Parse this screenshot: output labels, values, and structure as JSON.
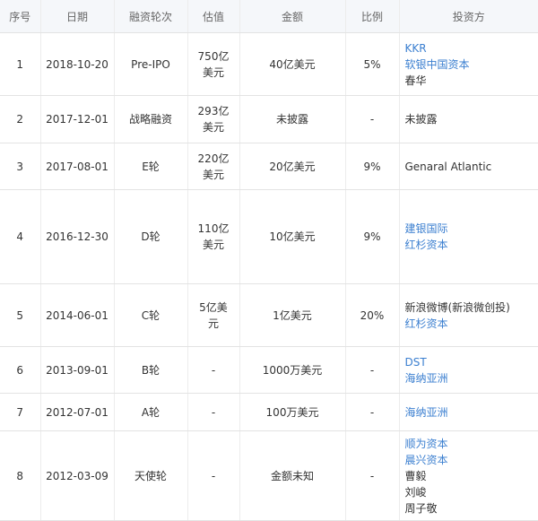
{
  "headers": [
    "序号",
    "日期",
    "融资轮次",
    "估值",
    "金额",
    "比例",
    "投资方"
  ],
  "rows": [
    {
      "no": "1",
      "date": "2018-10-20",
      "round": "Pre-IPO",
      "valuation": [
        "750亿",
        "美元"
      ],
      "amount": "40亿美元",
      "ratio": "5%",
      "investors": [
        {
          "name": "KKR",
          "link": true
        },
        {
          "name": "软银中国资本",
          "link": true
        },
        {
          "name": "春华",
          "link": false
        }
      ]
    },
    {
      "no": "2",
      "date": "2017-12-01",
      "round": "战略融资",
      "valuation": [
        "293亿",
        "美元"
      ],
      "amount": "未披露",
      "ratio": "-",
      "investors": [
        {
          "name": "未披露",
          "link": false
        }
      ]
    },
    {
      "no": "3",
      "date": "2017-08-01",
      "round": "E轮",
      "valuation": [
        "220亿",
        "美元"
      ],
      "amount": "20亿美元",
      "ratio": "9%",
      "investors": [
        {
          "name": "Genaral Atlantic",
          "link": false
        }
      ]
    },
    {
      "no": "4",
      "date": "2016-12-30",
      "round": "D轮",
      "valuation": [
        "110亿",
        "美元"
      ],
      "amount": "10亿美元",
      "ratio": "9%",
      "investors": [
        {
          "name": "建银国际",
          "link": true
        },
        {
          "name": "红杉资本",
          "link": true
        }
      ]
    },
    {
      "no": "5",
      "date": "2014-06-01",
      "round": "C轮",
      "valuation": [
        "5亿美",
        "元"
      ],
      "amount": "1亿美元",
      "ratio": "20%",
      "investors": [
        {
          "name": "新浪微博(新浪微创投)",
          "link": false
        },
        {
          "name": "红杉资本",
          "link": true
        }
      ]
    },
    {
      "no": "6",
      "date": "2013-09-01",
      "round": "B轮",
      "valuation": [
        "-"
      ],
      "amount": "1000万美元",
      "ratio": "-",
      "investors": [
        {
          "name": "DST",
          "link": true
        },
        {
          "name": "海纳亚洲",
          "link": true
        }
      ]
    },
    {
      "no": "7",
      "date": "2012-07-01",
      "round": "A轮",
      "valuation": [
        "-"
      ],
      "amount": "100万美元",
      "ratio": "-",
      "investors": [
        {
          "name": "海纳亚洲",
          "link": true
        }
      ]
    },
    {
      "no": "8",
      "date": "2012-03-09",
      "round": "天使轮",
      "valuation": [
        "-"
      ],
      "amount": "金额未知",
      "ratio": "-",
      "investors": [
        {
          "name": "顺为资本",
          "link": true
        },
        {
          "name": "晨兴资本",
          "link": true
        },
        {
          "name": "曹毅",
          "link": false
        },
        {
          "name": "刘峻",
          "link": false
        },
        {
          "name": "周子敬",
          "link": false
        }
      ]
    }
  ]
}
